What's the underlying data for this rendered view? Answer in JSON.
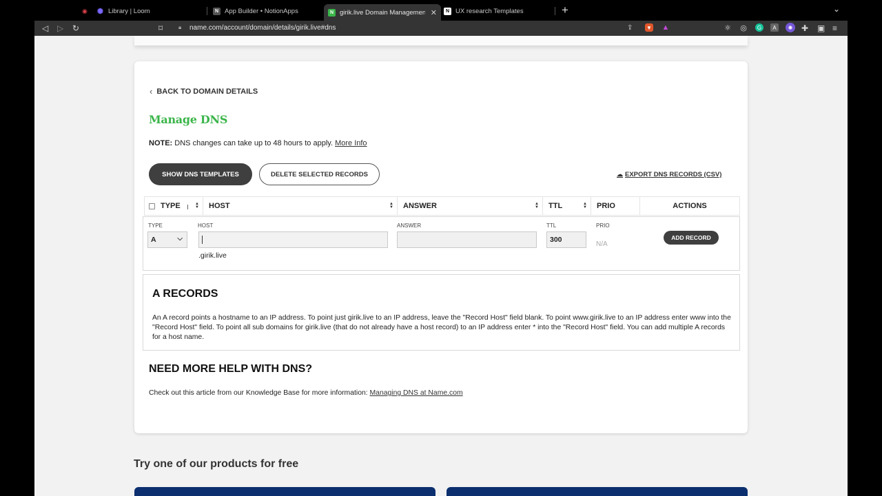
{
  "browser": {
    "tabs": [
      {
        "title": "Library | Loom",
        "fav_color": "#5b47e0",
        "fav_glyph": "✺"
      },
      {
        "title": "App Builder • NotionApps",
        "fav_color": "#444444",
        "fav_glyph": "N"
      },
      {
        "title": "girik.live Domain Management | ",
        "fav_color": "#3bb54a",
        "fav_glyph": "N"
      },
      {
        "title": "UX research Templates",
        "fav_color": "#ffffff",
        "fav_glyph": "N"
      }
    ],
    "url": "name.com/account/domain/details/girik.live#dns",
    "ext_badge": "4"
  },
  "page": {
    "back_label": "BACK TO DOMAIN DETAILS",
    "title": "Manage DNS",
    "note_label": "NOTE:",
    "note_text": " DNS changes can take up to 48 hours to apply. ",
    "note_link": "More Info",
    "show_templates": "SHOW DNS TEMPLATES",
    "delete_selected": "DELETE SELECTED RECORDS",
    "export": "EXPORT DNS RECORDS (CSV)",
    "table_headers": {
      "type": "TYPE",
      "host": "HOST",
      "answer": "ANSWER",
      "ttl": "TTL",
      "prio": "PRIO",
      "actions": "ACTIONS"
    },
    "add_row": {
      "type_label": "TYPE",
      "type_value": "A",
      "host_label": "HOST",
      "host_value": "",
      "host_suffix": ".girik.live",
      "answer_label": "ANSWER",
      "answer_value": "",
      "ttl_label": "TTL",
      "ttl_value": "300",
      "prio_label": "PRIO",
      "prio_value": "N/A",
      "add_button": "ADD RECORD"
    },
    "info": {
      "title": "A RECORDS",
      "body": "An A record points a hostname to an IP address. To point just girik.live to an IP address, leave the \"Record Host\" field blank. To point www.girik.live to an IP address enter www into the \"Record Host\" field. To point all sub domains for girik.live (that do not already have a host record) to an IP address enter * into the \"Record Host\" field. You can add multiple A records for a host name."
    },
    "help": {
      "title": "NEED MORE HELP WITH DNS?",
      "text": "Check out this article from our Knowledge Base for more information: ",
      "link": "Managing DNS at Name.com"
    },
    "promo_title": "Try one of our products for free"
  },
  "colors": {
    "brand_green": "#3bb54a",
    "dark_button": "#3f3f3f",
    "promo_blue": "#0b2f6f"
  }
}
